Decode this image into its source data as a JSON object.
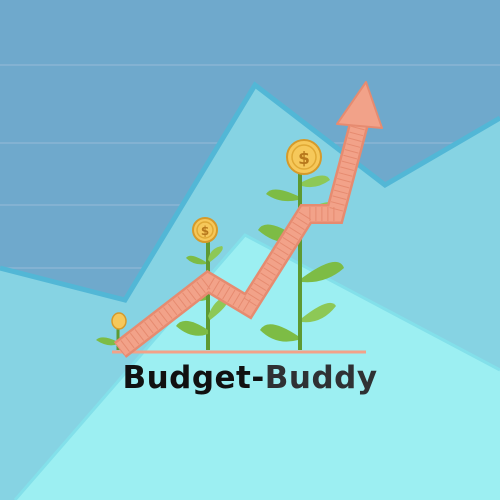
{
  "brand": {
    "name_part1": "Budget-",
    "name_part2": "Buddy"
  },
  "coin_symbol": "$",
  "icons": [
    "growth-arrow-icon",
    "dollar-coin-icon",
    "sprout-icon"
  ],
  "colors": {
    "sky": "#6fa9cc",
    "mid_area": "#86d3e3",
    "front_area": "#9ceff2",
    "arrow": "#f2a289",
    "leaf": "#7dbc45",
    "coin": "#f6c85a",
    "text_dark": "#111111"
  }
}
